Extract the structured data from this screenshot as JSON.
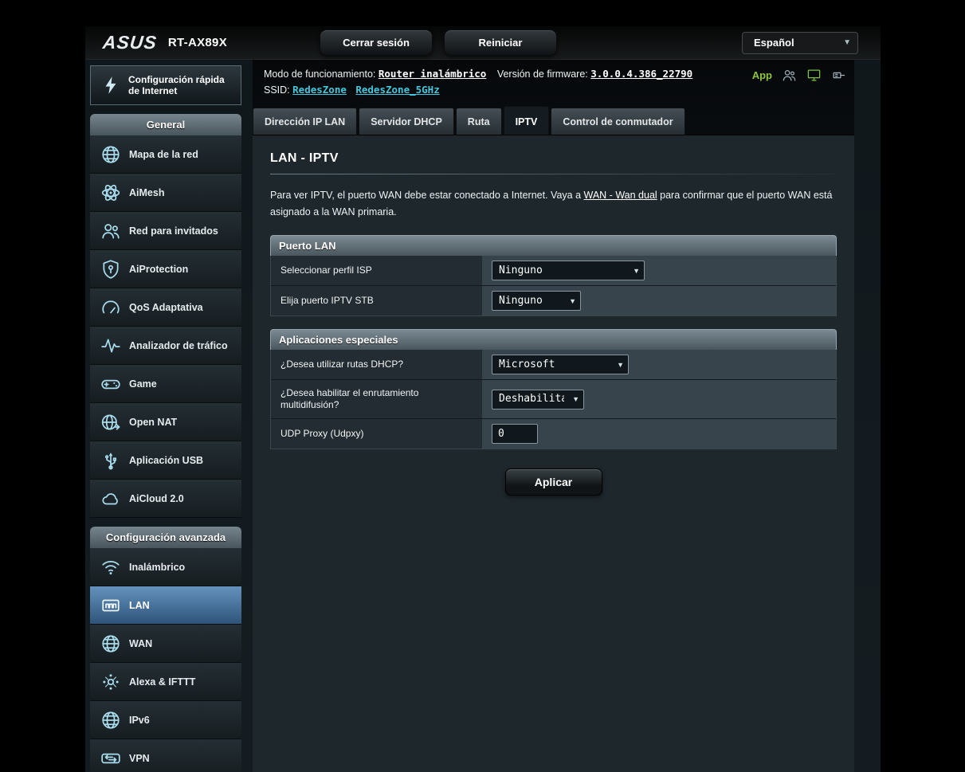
{
  "palette": {
    "accent_cyan": "#45c6dc",
    "accent_green": "#8cc63e",
    "active_nav_blue": "#3f6f9f",
    "section_header_gray": "#5c6b75"
  },
  "header": {
    "brand": "ASUS",
    "model": "RT-AX89X",
    "logout_label": "Cerrar sesión",
    "reboot_label": "Reiniciar",
    "language": "Español"
  },
  "status": {
    "mode_label": "Modo de funcionamiento:",
    "mode_value": "Router inalámbrico",
    "firmware_label": "Versión de firmware:",
    "firmware_value": "3.0.0.4.386_22790",
    "ssid_label": "SSID:",
    "ssid_values": [
      "RedesZone",
      "RedesZone_5GHz"
    ],
    "app_label": "App",
    "icons": [
      "users-icon",
      "monitor-icon",
      "usb-plug-icon"
    ]
  },
  "tabs": [
    {
      "label": "Dirección IP LAN",
      "active": false
    },
    {
      "label": "Servidor DHCP",
      "active": false
    },
    {
      "label": "Ruta",
      "active": false
    },
    {
      "label": "IPTV",
      "active": true
    },
    {
      "label": "Control de conmutador",
      "active": false
    }
  ],
  "sidebar": {
    "quick_setup": {
      "label": "Configuración rápida de Internet",
      "icon": "quick-setup-icon"
    },
    "sections": [
      {
        "header": "General",
        "items": [
          {
            "label": "Mapa de la red",
            "icon": "globe-icon",
            "active": false
          },
          {
            "label": "AiMesh",
            "icon": "mesh-icon",
            "active": false
          },
          {
            "label": "Red para invitados",
            "icon": "guests-icon",
            "active": false
          },
          {
            "label": "AiProtection",
            "icon": "shield-icon",
            "active": false
          },
          {
            "label": "QoS Adaptativa",
            "icon": "gauge-icon",
            "active": false
          },
          {
            "label": "Analizador de tráfico",
            "icon": "traffic-pulse-icon",
            "active": false
          },
          {
            "label": "Game",
            "icon": "gamepad-icon",
            "active": false
          },
          {
            "label": "Open NAT",
            "icon": "nat-globe-icon",
            "active": false
          },
          {
            "label": "Aplicación USB",
            "icon": "usb-icon",
            "active": false
          },
          {
            "label": "AiCloud 2.0",
            "icon": "cloud-icon",
            "active": false
          }
        ]
      },
      {
        "header": "Configuración avanzada",
        "items": [
          {
            "label": "Inalámbrico",
            "icon": "wifi-icon",
            "active": false
          },
          {
            "label": "LAN",
            "icon": "lan-ports-icon",
            "active": true
          },
          {
            "label": "WAN",
            "icon": "globe-icon",
            "active": false
          },
          {
            "label": "Alexa & IFTTT",
            "icon": "alexa-dots-icon",
            "active": false
          },
          {
            "label": "IPv6",
            "icon": "ipv6-globe-icon",
            "active": false
          },
          {
            "label": "VPN",
            "icon": "vpn-arrows-icon",
            "active": false
          }
        ]
      }
    ]
  },
  "main": {
    "title": "LAN - IPTV",
    "description": {
      "before": "Para ver IPTV, el puerto WAN debe estar conectado a Internet. Vaya a ",
      "link": "WAN - Wan dual",
      "after": " para confirmar que el puerto WAN está asignado a la WAN primaria."
    },
    "sections": [
      {
        "title": "Puerto LAN",
        "rows": [
          {
            "label": "Seleccionar perfil ISP",
            "control": "select",
            "value": "Ninguno"
          },
          {
            "label": "Elija puerto IPTV STB",
            "control": "select",
            "value": "Ninguno"
          }
        ]
      },
      {
        "title": "Aplicaciones especiales",
        "rows": [
          {
            "label": "¿Desea utilizar rutas DHCP?",
            "control": "select",
            "value": "Microsoft"
          },
          {
            "label": "¿Desea habilitar el enrutamiento multidifusión?",
            "control": "select",
            "value": "Deshabilitar"
          },
          {
            "label": "UDP Proxy (Udpxy)",
            "control": "input",
            "value": "0"
          }
        ]
      }
    ],
    "apply_label": "Aplicar"
  }
}
